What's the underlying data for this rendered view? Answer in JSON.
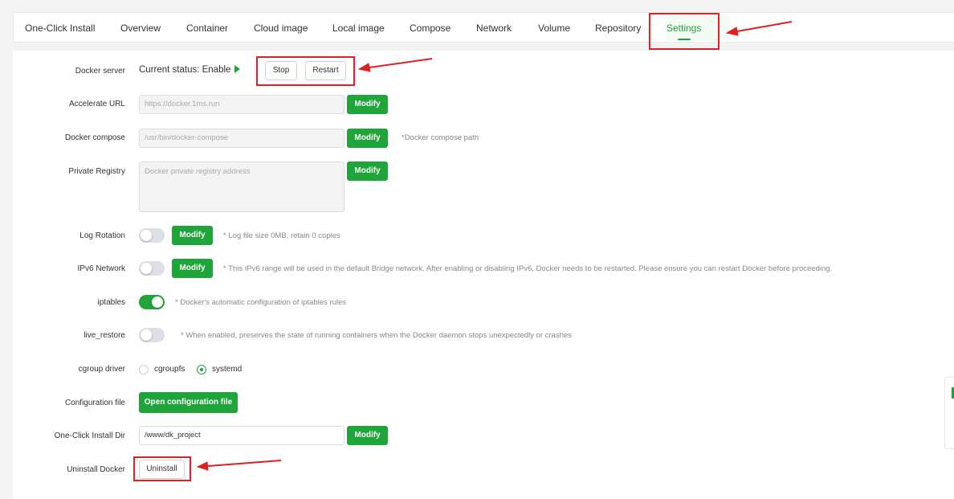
{
  "tabs": [
    {
      "label": "One-Click Install"
    },
    {
      "label": "Overview"
    },
    {
      "label": "Container"
    },
    {
      "label": "Cloud image"
    },
    {
      "label": "Local image"
    },
    {
      "label": "Compose"
    },
    {
      "label": "Network"
    },
    {
      "label": "Volume"
    },
    {
      "label": "Repository"
    },
    {
      "label": "Settings",
      "active": true
    }
  ],
  "settings": {
    "docker_server": {
      "label": "Docker server",
      "status": "Current status: Enable",
      "stop_label": "Stop",
      "restart_label": "Restart"
    },
    "accelerate_url": {
      "label": "Accelerate URL",
      "placeholder": "https://docker.1ms.run",
      "button": "Modify"
    },
    "docker_compose": {
      "label": "Docker compose",
      "placeholder": "/usr/bin/docker-compose",
      "button": "Modify",
      "hint": "*Docker compose path"
    },
    "private_registry": {
      "label": "Private Registry",
      "placeholder": "Docker private registry address",
      "button": "Modify"
    },
    "log_rotation": {
      "label": "Log Rotation",
      "enabled": false,
      "button": "Modify",
      "hint": "* Log file size 0MB, retain 0 copies"
    },
    "ipv6_network": {
      "label": "IPv6 Network",
      "enabled": false,
      "button": "Modify",
      "hint": "* This IPv6 range will be used in the default Bridge network. After enabling or disabling IPv6, Docker needs to be restarted. Please ensure you can restart Docker before proceeding."
    },
    "iptables": {
      "label": "iptables",
      "enabled": true,
      "hint": "* Docker's automatic configuration of iptables rules"
    },
    "live_restore": {
      "label": "live_restore",
      "enabled": false,
      "hint": "* When enabled, preserves the state of running containers when the Docker daemon stops unexpectedly or crashes"
    },
    "cgroup_driver": {
      "label": "cgroup driver",
      "options": [
        "cgroupfs",
        "systemd"
      ],
      "selected": "systemd"
    },
    "config_file": {
      "label": "Configuration file",
      "button": "Open configuration file"
    },
    "install_dir": {
      "label": "One-Click Install Dir",
      "value": "/www/dk_project",
      "button": "Modify"
    },
    "uninstall": {
      "label": "Uninstall Docker",
      "button": "Uninstall"
    }
  },
  "colors": {
    "accent": "#20a53a",
    "annotation": "#e02020"
  }
}
